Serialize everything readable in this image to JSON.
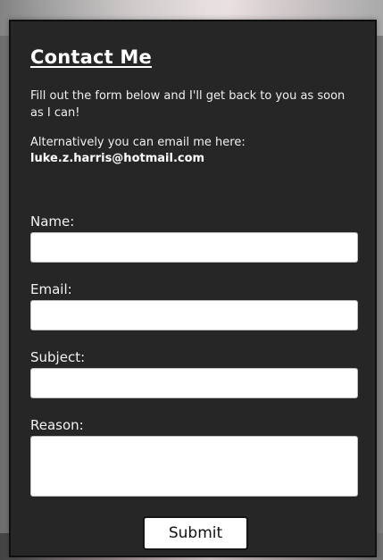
{
  "form": {
    "title": "Contact Me",
    "intro": "Fill out the form below and I'll get back to you as soon as I can!",
    "alternative_text": "Alternatively you can email me here:",
    "email_address": "luke.z.harris@hotmail.com",
    "fields": {
      "name_label": "Name:",
      "name_value": "",
      "email_label": "Email:",
      "email_value": "",
      "subject_label": "Subject:",
      "subject_value": "",
      "reason_label": "Reason:",
      "reason_value": ""
    },
    "submit_label": "Submit"
  },
  "colors": {
    "panel_background": "#262626",
    "text": "#ffffff",
    "input_background": "#ffffff"
  }
}
